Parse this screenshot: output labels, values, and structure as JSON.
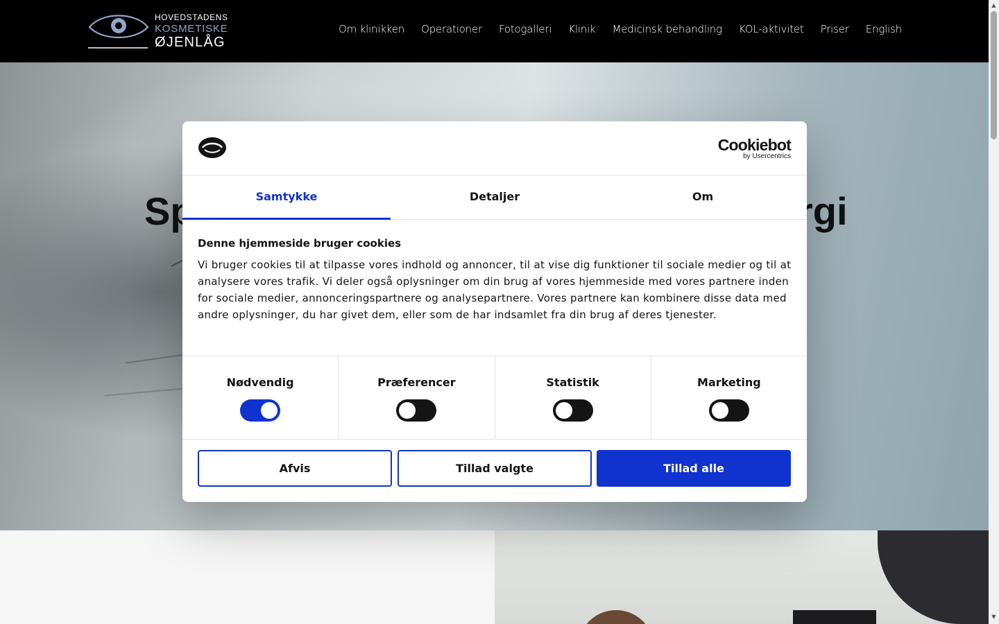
{
  "header": {
    "logo": {
      "line1": "HOVEDSTADENS",
      "line2": "KOSMETISKE",
      "line3": "ØJENLÅG"
    },
    "nav": [
      {
        "label": "Om klinikken"
      },
      {
        "label": "Operationer"
      },
      {
        "label": "Fotogalleri"
      },
      {
        "label": "Klinik"
      },
      {
        "label": "Medicinsk behandling"
      },
      {
        "label": "KOL-aktivitet"
      },
      {
        "label": "Priser"
      },
      {
        "label": "English"
      }
    ]
  },
  "hero": {
    "title_visible_start": "Sp",
    "title_visible_end": "rgi"
  },
  "cookie_dialog": {
    "brand": {
      "name": "Cookiebot",
      "byline": "by Usercentrics"
    },
    "tabs": [
      {
        "label": "Samtykke",
        "active": true
      },
      {
        "label": "Detaljer",
        "active": false
      },
      {
        "label": "Om",
        "active": false
      }
    ],
    "title": "Denne hjemmeside bruger cookies",
    "text": "Vi bruger cookies til at tilpasse vores indhold og annoncer, til at vise dig funktioner til sociale medier og til at analysere vores trafik. Vi deler også oplysninger om din brug af vores hjemmeside med vores partnere inden for sociale medier, annonceringspartnere og analysepartnere. Vores partnere kan kombinere disse data med andre oplysninger, du har givet dem, eller som de har indsamlet fra din brug af deres tjenester.",
    "categories": [
      {
        "label": "Nødvendig",
        "enabled": true
      },
      {
        "label": "Præferencer",
        "enabled": false
      },
      {
        "label": "Statistik",
        "enabled": false
      },
      {
        "label": "Marketing",
        "enabled": false
      }
    ],
    "buttons": {
      "reject": "Afvis",
      "allow_selected": "Tillad valgte",
      "allow_all": "Tillad alle"
    },
    "colors": {
      "accent": "#1032cf",
      "text": "#141414"
    }
  }
}
